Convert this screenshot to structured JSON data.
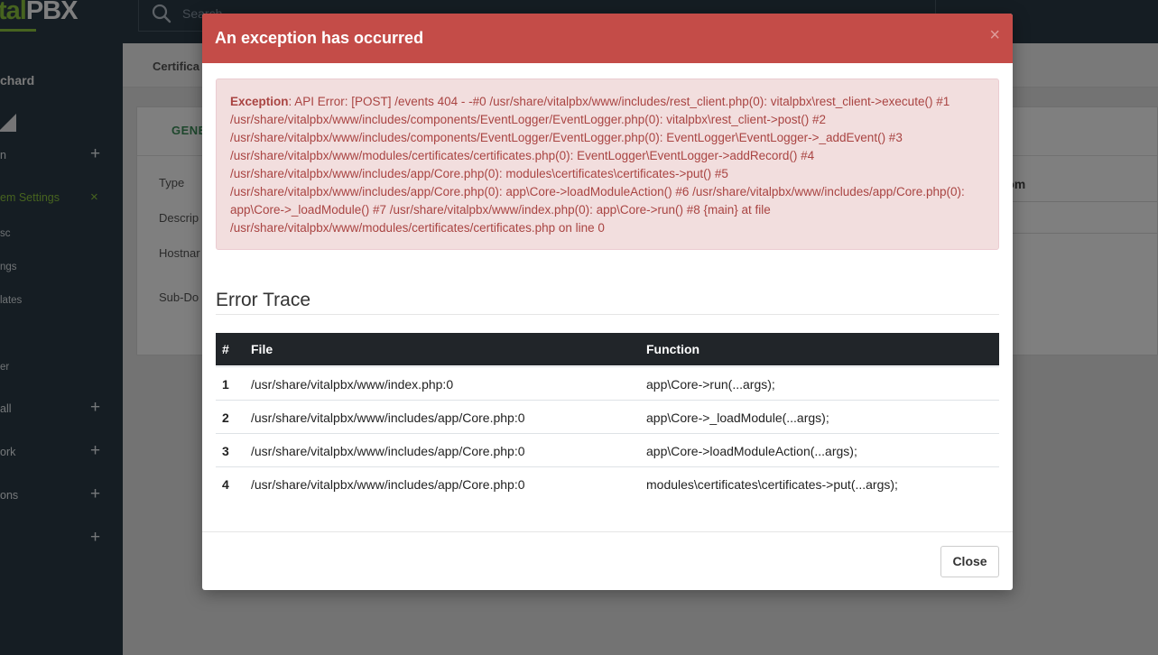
{
  "app": {
    "logo_a": "tal",
    "logo_b": "PBX",
    "search_placeholder": "Search",
    "user_name": "chard",
    "breadcrumb": "Certifica",
    "tab_general": "GENE",
    "nav": [
      {
        "label": "n",
        "action": "+"
      },
      {
        "label": "em Settings",
        "action": "×"
      },
      {
        "label": "sc"
      },
      {
        "label": "ngs"
      },
      {
        "label": "lates"
      },
      {
        "label": "er"
      },
      {
        "label": "all",
        "action": "+"
      },
      {
        "label": "ork",
        "action": "+"
      },
      {
        "label": "ons",
        "action": "+"
      },
      {
        "label": "",
        "action": "+"
      }
    ],
    "form_labels": [
      "Type",
      "Descrip",
      "Hostnar",
      "Sub-Do"
    ],
    "hostname_value_fragment": "o.com",
    "accent_color": "#8dc63f",
    "sidebar_color": "#2b3a46"
  },
  "modal": {
    "title": "An exception has occurred",
    "close_x": "×",
    "header_color": "#c44c48",
    "exception_label": "Exception",
    "exception_text": ": API Error: [POST] /events 404 - -#0 /usr/share/vitalpbx/www/includes/rest_client.php(0): vitalpbx\\rest_client->execute() #1 /usr/share/vitalpbx/www/includes/components/EventLogger/EventLogger.php(0): vitalpbx\\rest_client->post() #2 /usr/share/vitalpbx/www/includes/components/EventLogger/EventLogger.php(0): EventLogger\\EventLogger->_addEvent() #3 /usr/share/vitalpbx/www/modules/certificates/certificates.php(0): EventLogger\\EventLogger->addRecord() #4 /usr/share/vitalpbx/www/includes/app/Core.php(0): modules\\certificates\\certificates->put() #5 /usr/share/vitalpbx/www/includes/app/Core.php(0): app\\Core->loadModuleAction() #6 /usr/share/vitalpbx/www/includes/app/Core.php(0): app\\Core->_loadModule() #7 /usr/share/vitalpbx/www/index.php(0): app\\Core->run() #8 {main} at file /usr/share/vitalpbx/www/modules/certificates/certificates.php on line 0",
    "trace_title": "Error Trace",
    "columns": {
      "num": "#",
      "file": "File",
      "function": "Function"
    },
    "rows": [
      {
        "num": "1",
        "file": "/usr/share/vitalpbx/www/index.php:0",
        "function": "app\\Core->run(...args);"
      },
      {
        "num": "2",
        "file": "/usr/share/vitalpbx/www/includes/app/Core.php:0",
        "function": "app\\Core->_loadModule(...args);"
      },
      {
        "num": "3",
        "file": "/usr/share/vitalpbx/www/includes/app/Core.php:0",
        "function": "app\\Core->loadModuleAction(...args);"
      },
      {
        "num": "4",
        "file": "/usr/share/vitalpbx/www/includes/app/Core.php:0",
        "function": "modules\\certificates\\certificates->put(...args);"
      }
    ],
    "close_button": "Close"
  }
}
